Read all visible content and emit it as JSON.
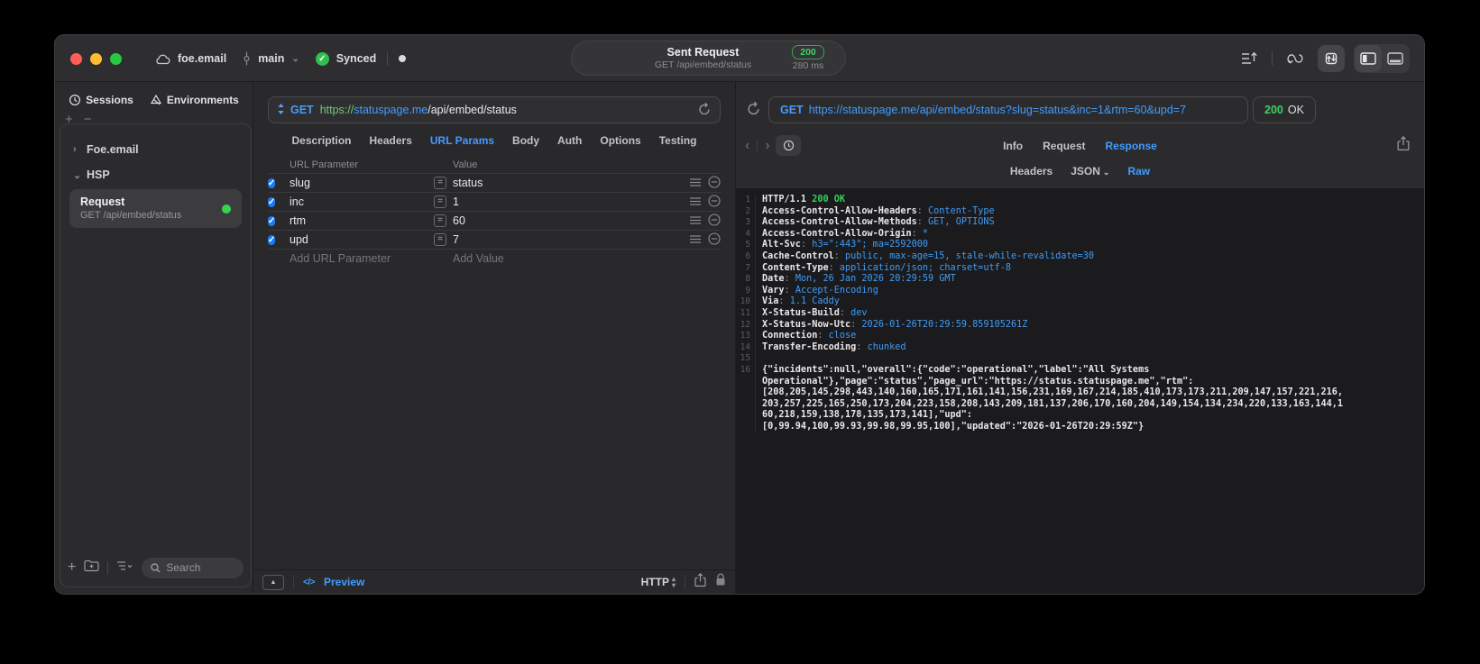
{
  "titlebar": {
    "project": "foe.email",
    "branch": "main",
    "sync": "Synced",
    "center": {
      "title": "Sent Request",
      "subtitle": "GET /api/embed/status",
      "status": "200",
      "time": "280 ms"
    }
  },
  "sidebar": {
    "tabs": [
      {
        "label": "Sessions"
      },
      {
        "label": "Environments"
      }
    ],
    "groups": [
      {
        "label": "Foe.email",
        "chevron": "›"
      },
      {
        "label": "HSP",
        "chevron": "⌄"
      }
    ],
    "request": {
      "title": "Request",
      "subtitle": "GET /api/embed/status"
    },
    "search_placeholder": "Search"
  },
  "request_editor": {
    "method": "GET",
    "scheme": "https://",
    "host": "statuspage.me",
    "path": "/api/embed/status",
    "tabs": [
      "Description",
      "Headers",
      "URL Params",
      "Body",
      "Auth",
      "Options",
      "Testing"
    ],
    "active_tab": "URL Params",
    "table": {
      "col_param": "URL Parameter",
      "col_value": "Value",
      "rows": [
        {
          "name": "slug",
          "value": "status",
          "enabled": true
        },
        {
          "name": "inc",
          "value": "1",
          "enabled": true
        },
        {
          "name": "rtm",
          "value": "60",
          "enabled": true
        },
        {
          "name": "upd",
          "value": "7",
          "enabled": true
        }
      ],
      "add_param": "Add URL Parameter",
      "add_value": "Add Value"
    },
    "footer": {
      "code_glyph": "</>",
      "preview": "Preview",
      "protocol": "HTTP"
    }
  },
  "response_viewer": {
    "method": "GET",
    "url": "https://statuspage.me/api/embed/status?slug=status&inc=1&rtm=60&upd=7",
    "status_code": "200",
    "status_text": "OK",
    "tabs": [
      "Info",
      "Request",
      "Response"
    ],
    "active_tab": "Response",
    "subtabs": [
      {
        "label": "Headers"
      },
      {
        "label": "JSON",
        "chevron": true
      },
      {
        "label": "Raw"
      }
    ],
    "active_subtab": "Raw",
    "lines": [
      {
        "n": "1",
        "segs": [
          {
            "t": "HTTP/1.1 ",
            "c": "w"
          },
          {
            "t": "200 OK",
            "c": "g"
          }
        ]
      },
      {
        "n": "2",
        "segs": [
          {
            "t": "Access-Control-Allow-Headers",
            "c": "w"
          },
          {
            "t": ": ",
            "c": "d"
          },
          {
            "t": "Content-Type",
            "c": "b"
          }
        ]
      },
      {
        "n": "3",
        "segs": [
          {
            "t": "Access-Control-Allow-Methods",
            "c": "w"
          },
          {
            "t": ": ",
            "c": "d"
          },
          {
            "t": "GET, OPTIONS",
            "c": "b"
          }
        ]
      },
      {
        "n": "4",
        "segs": [
          {
            "t": "Access-Control-Allow-Origin",
            "c": "w"
          },
          {
            "t": ": ",
            "c": "d"
          },
          {
            "t": "*",
            "c": "b"
          }
        ]
      },
      {
        "n": "5",
        "segs": [
          {
            "t": "Alt-Svc",
            "c": "w"
          },
          {
            "t": ": ",
            "c": "d"
          },
          {
            "t": "h3=\":443\"; ma=2592000",
            "c": "b"
          }
        ]
      },
      {
        "n": "6",
        "segs": [
          {
            "t": "Cache-Control",
            "c": "w"
          },
          {
            "t": ": ",
            "c": "d"
          },
          {
            "t": "public, max-age=15, stale-while-revalidate=30",
            "c": "b"
          }
        ]
      },
      {
        "n": "7",
        "segs": [
          {
            "t": "Content-Type",
            "c": "w"
          },
          {
            "t": ": ",
            "c": "d"
          },
          {
            "t": "application/json; charset=utf-8",
            "c": "b"
          }
        ]
      },
      {
        "n": "8",
        "segs": [
          {
            "t": "Date",
            "c": "w"
          },
          {
            "t": ": ",
            "c": "d"
          },
          {
            "t": "Mon, 26 Jan 2026 20:29:59 GMT",
            "c": "b"
          }
        ]
      },
      {
        "n": "9",
        "segs": [
          {
            "t": "Vary",
            "c": "w"
          },
          {
            "t": ": ",
            "c": "d"
          },
          {
            "t": "Accept-Encoding",
            "c": "b"
          }
        ]
      },
      {
        "n": "10",
        "segs": [
          {
            "t": "Via",
            "c": "w"
          },
          {
            "t": ": ",
            "c": "d"
          },
          {
            "t": "1.1 Caddy",
            "c": "b"
          }
        ]
      },
      {
        "n": "11",
        "segs": [
          {
            "t": "X-Status-Build",
            "c": "w"
          },
          {
            "t": ": ",
            "c": "d"
          },
          {
            "t": "dev",
            "c": "b"
          }
        ]
      },
      {
        "n": "12",
        "segs": [
          {
            "t": "X-Status-Now-Utc",
            "c": "w"
          },
          {
            "t": ": ",
            "c": "d"
          },
          {
            "t": "2026-01-26T20:29:59.859105261Z",
            "c": "b"
          }
        ]
      },
      {
        "n": "13",
        "segs": [
          {
            "t": "Connection",
            "c": "w"
          },
          {
            "t": ": ",
            "c": "d"
          },
          {
            "t": "close",
            "c": "b"
          }
        ]
      },
      {
        "n": "14",
        "segs": [
          {
            "t": "Transfer-Encoding",
            "c": "w"
          },
          {
            "t": ": ",
            "c": "d"
          },
          {
            "t": "chunked",
            "c": "b"
          }
        ]
      },
      {
        "n": "15",
        "segs": []
      },
      {
        "n": "16",
        "segs": [
          {
            "t": "{\"incidents\":null,\"overall\":{\"code\":\"operational\",\"label\":\"All Systems\nOperational\"},\"page\":\"status\",\"page_url\":\"https://status.statuspage.me\",\"rtm\":\n[208,205,145,298,443,140,160,165,171,161,141,156,231,169,167,214,185,410,173,173,211,209,147,157,221,216,\n203,257,225,165,250,173,204,223,158,208,143,209,181,137,206,170,160,204,149,154,134,234,220,133,163,144,1\n60,218,159,138,178,135,173,141],\"upd\":\n[0,99.94,100,99.93,99.98,99.95,100],\"updated\":\"2026-01-26T20:29:59Z\"}",
            "c": "w"
          }
        ]
      }
    ]
  },
  "colors": {
    "accent_blue": "#419cff",
    "green": "#31d158",
    "scheme_green": "#76c775",
    "checkbox_blue": "#1a7cf0"
  }
}
